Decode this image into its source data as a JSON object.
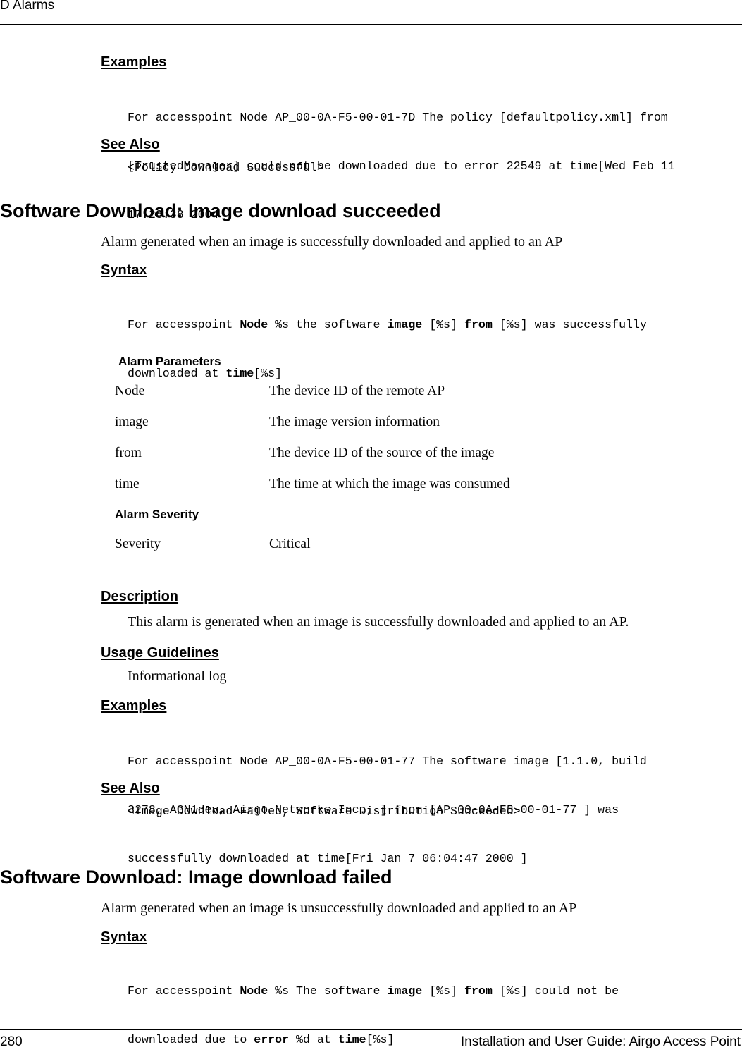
{
  "header": {
    "title": "D  Alarms"
  },
  "footer": {
    "page_number": "280",
    "guide_title": "Installation and User Guide: Airgo Access Point"
  },
  "prev_section": {
    "examples_heading": "Examples",
    "examples_lines": [
      "For accesspoint Node AP_00-0A-F5-00-01-7D The policy [defaultpolicy.xml] from",
      "[TrustedManager] could not be downloaded due to error 22549 at time[Wed Feb 11",
      "17:28:38 2004 ]"
    ],
    "see_also_heading": "See Also",
    "see_also_text": "<Policy Download Successful>"
  },
  "section1": {
    "title": "Software Download: Image download succeeded",
    "summary": "Alarm generated when an image is successfully downloaded and applied to an AP",
    "syntax_heading": "Syntax",
    "syntax_line1": [
      {
        "t": "For accesspoint ",
        "b": false
      },
      {
        "t": "Node",
        "b": true
      },
      {
        "t": " %s the software ",
        "b": false
      },
      {
        "t": "image",
        "b": true
      },
      {
        "t": " [%s] ",
        "b": false
      },
      {
        "t": "from",
        "b": true
      },
      {
        "t": " [%s] was successfully",
        "b": false
      }
    ],
    "syntax_line2": [
      {
        "t": "downloaded at ",
        "b": false
      },
      {
        "t": "time",
        "b": true
      },
      {
        "t": "[%s]",
        "b": false
      }
    ],
    "params_heading": "Alarm Parameters",
    "params": [
      {
        "name": "Node",
        "desc": "The device ID of the remote AP"
      },
      {
        "name": "image",
        "desc": "The image version information"
      },
      {
        "name": "from",
        "desc": "The device ID of the source of the image"
      },
      {
        "name": "time",
        "desc": "The time at which the image was consumed"
      }
    ],
    "severity_heading": "Alarm Severity",
    "severity_label": "Severity",
    "severity_value": "Critical",
    "description_heading": "Description",
    "description_text": "This alarm is generated when an image is successfully downloaded and applied to an AP.",
    "usage_heading": "Usage Guidelines",
    "usage_text": "Informational log",
    "examples_heading": "Examples",
    "examples_lines": [
      "For accesspoint Node AP_00-0A-F5-00-01-77 The software image [1.1.0, build",
      "3278, AGN1dev, Airgo Networks Inc., ] from [AP_00-0A-F5-00-01-77 ] was",
      "successfully downloaded at time[Fri Jan 7 06:04:47 2000 ]"
    ],
    "see_also_heading": "See Also",
    "see_also_text": "<Image Download Failed, Software Distribution Succeeded>"
  },
  "section2": {
    "title": "Software Download: Image download failed",
    "summary": "Alarm generated when an image is unsuccessfully downloaded and applied to an AP",
    "syntax_heading": "Syntax",
    "syntax_line1": [
      {
        "t": "For accesspoint ",
        "b": false
      },
      {
        "t": "Node",
        "b": true
      },
      {
        "t": " %s The software ",
        "b": false
      },
      {
        "t": "image",
        "b": true
      },
      {
        "t": " [%s] ",
        "b": false
      },
      {
        "t": "from",
        "b": true
      },
      {
        "t": " [%s] could not be",
        "b": false
      }
    ],
    "syntax_line2": [
      {
        "t": "downloaded due to ",
        "b": false
      },
      {
        "t": "error",
        "b": true
      },
      {
        "t": " %d at ",
        "b": false
      },
      {
        "t": "time",
        "b": true
      },
      {
        "t": "[%s]",
        "b": false
      }
    ]
  }
}
